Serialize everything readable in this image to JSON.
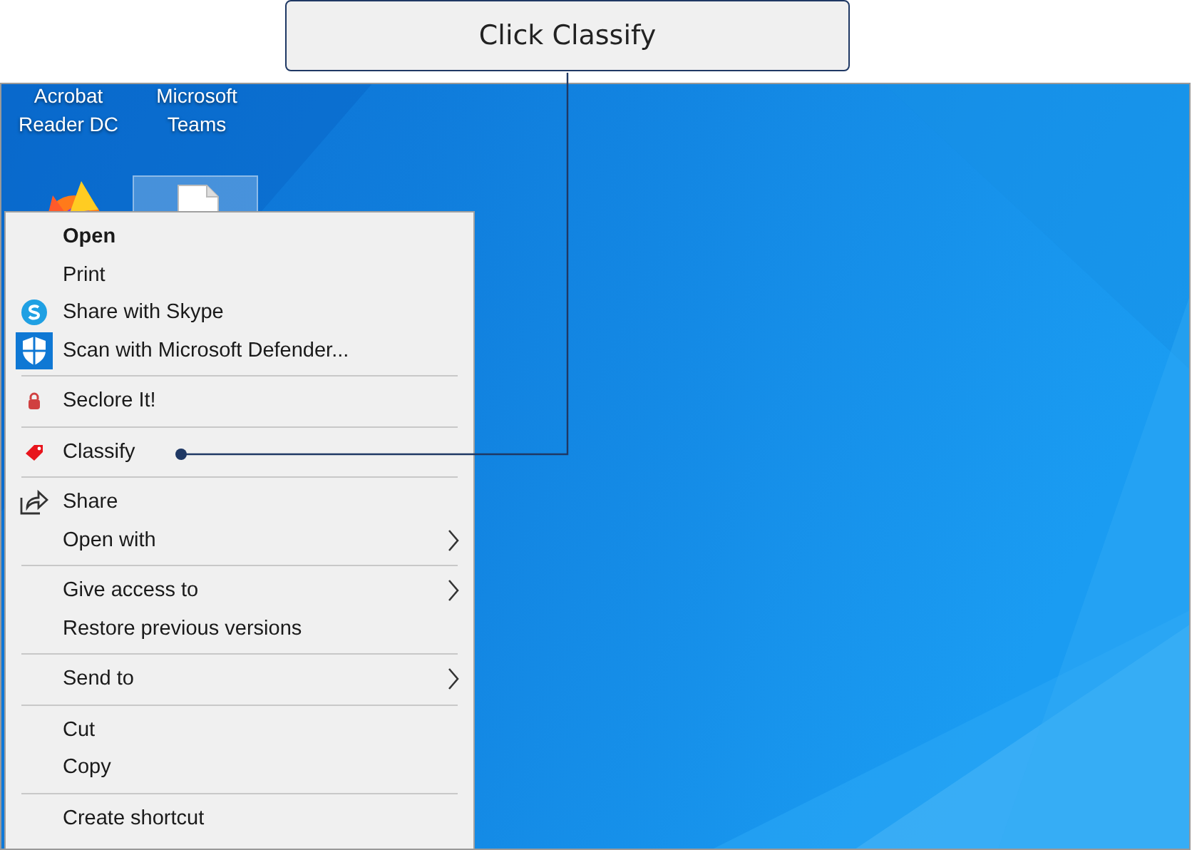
{
  "callout": {
    "text": "Click Classify"
  },
  "desktop": {
    "shortcuts": [
      {
        "label": "Acrobat Reader DC"
      },
      {
        "label": "Microsoft Teams"
      }
    ],
    "files": [
      {
        "selected": false
      },
      {
        "selected": true
      }
    ]
  },
  "context_menu": {
    "groups": [
      [
        {
          "label": "Open",
          "default": true,
          "submenu": false
        },
        {
          "label": "Print",
          "default": false,
          "submenu": false
        },
        {
          "label": "Share with Skype",
          "default": false,
          "submenu": false
        },
        {
          "label": "Scan with Microsoft Defender...",
          "default": false,
          "submenu": false
        }
      ],
      [
        {
          "label": "Seclore It!",
          "default": false,
          "submenu": false
        }
      ],
      [
        {
          "label": "Classify",
          "default": false,
          "submenu": false
        }
      ],
      [
        {
          "label": "Share",
          "default": false,
          "submenu": false
        },
        {
          "label": "Open with",
          "default": false,
          "submenu": true
        }
      ],
      [
        {
          "label": "Give access to",
          "default": false,
          "submenu": true
        },
        {
          "label": "Restore previous versions",
          "default": false,
          "submenu": false
        }
      ],
      [
        {
          "label": "Send to",
          "default": false,
          "submenu": true
        }
      ],
      [
        {
          "label": "Cut",
          "default": false,
          "submenu": false
        },
        {
          "label": "Copy",
          "default": false,
          "submenu": false
        }
      ],
      [
        {
          "label": "Create shortcut",
          "default": false,
          "submenu": false
        }
      ]
    ]
  }
}
